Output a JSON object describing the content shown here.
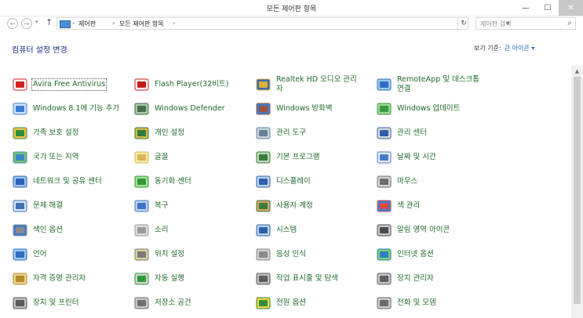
{
  "window": {
    "title": "모든 제어판 항목",
    "minimize": "—",
    "maximize": "☐",
    "close": "✕"
  },
  "nav": {
    "back": "←",
    "forward": "→",
    "dropdown": "▾",
    "up": "↑",
    "breadcrumb": [
      "제어판",
      "모든 제어판 항목"
    ],
    "separator": "›",
    "addr_dropdown": "▾",
    "refresh": "↻",
    "search_placeholder": "제어판 검색",
    "search_icon": "⌕"
  },
  "header": {
    "title": "컴퓨터 설정 변경",
    "view_by_label": "보기 기준:",
    "view_by_value": "큰 아이콘 ▾"
  },
  "columns": [
    {
      "items": [
        {
          "label": "Avira Free Antivirus",
          "icon": "avira-icon"
        },
        {
          "label": "Windows 8.1에 기능 추가",
          "icon": "windows-features-icon"
        },
        {
          "label": "가족 보호 설정",
          "icon": "family-safety-icon"
        },
        {
          "label": "국가 또는 지역",
          "icon": "region-icon"
        },
        {
          "label": "네트워크 및 공유 센터",
          "icon": "network-icon"
        },
        {
          "label": "문제 해결",
          "icon": "troubleshoot-icon"
        },
        {
          "label": "색인 옵션",
          "icon": "indexing-icon"
        },
        {
          "label": "언어",
          "icon": "language-icon"
        },
        {
          "label": "자격 증명 관리자",
          "icon": "credential-icon"
        },
        {
          "label": "장치 및 프린터",
          "icon": "devices-printers-icon"
        }
      ]
    },
    {
      "items": [
        {
          "label": "Flash Player(32비트)",
          "icon": "flash-icon"
        },
        {
          "label": "Windows Defender",
          "icon": "defender-icon"
        },
        {
          "label": "개인 설정",
          "icon": "personalization-icon"
        },
        {
          "label": "글꼴",
          "icon": "fonts-icon"
        },
        {
          "label": "동기화 센터",
          "icon": "sync-icon"
        },
        {
          "label": "복구",
          "icon": "recovery-icon"
        },
        {
          "label": "소리",
          "icon": "sound-icon"
        },
        {
          "label": "위치 설정",
          "icon": "location-icon"
        },
        {
          "label": "자동 실행",
          "icon": "autoplay-icon"
        },
        {
          "label": "저장소 공간",
          "icon": "storage-icon"
        }
      ]
    },
    {
      "items": [
        {
          "label": "Realtek HD 오디오 관리자",
          "icon": "realtek-icon"
        },
        {
          "label": "Windows 방화벽",
          "icon": "firewall-icon"
        },
        {
          "label": "관리 도구",
          "icon": "admin-tools-icon"
        },
        {
          "label": "기본 프로그램",
          "icon": "default-programs-icon"
        },
        {
          "label": "디스플레이",
          "icon": "display-icon"
        },
        {
          "label": "사용자 계정",
          "icon": "user-accounts-icon"
        },
        {
          "label": "시스템",
          "icon": "system-icon"
        },
        {
          "label": "음성 인식",
          "icon": "speech-icon"
        },
        {
          "label": "작업 표시줄 및 탐색",
          "icon": "taskbar-icon"
        },
        {
          "label": "전원 옵션",
          "icon": "power-icon"
        }
      ]
    },
    {
      "items": [
        {
          "label": "RemoteApp 및 데스크톱 연결",
          "icon": "remoteapp-icon"
        },
        {
          "label": "Windows 업데이트",
          "icon": "windows-update-icon"
        },
        {
          "label": "관리 센터",
          "icon": "action-center-icon"
        },
        {
          "label": "날짜 및 시간",
          "icon": "date-time-icon"
        },
        {
          "label": "마우스",
          "icon": "mouse-icon"
        },
        {
          "label": "색 관리",
          "icon": "color-management-icon"
        },
        {
          "label": "알림 영역 아이콘",
          "icon": "notification-icon"
        },
        {
          "label": "인터넷 옵션",
          "icon": "internet-options-icon"
        },
        {
          "label": "장치 관리자",
          "icon": "device-manager-icon"
        },
        {
          "label": "전화 및 모뎀",
          "icon": "phone-modem-icon"
        }
      ]
    }
  ],
  "colors": {
    "link": "#1d6b27",
    "heading": "#1e3287",
    "accent": "#1a5fb4"
  }
}
